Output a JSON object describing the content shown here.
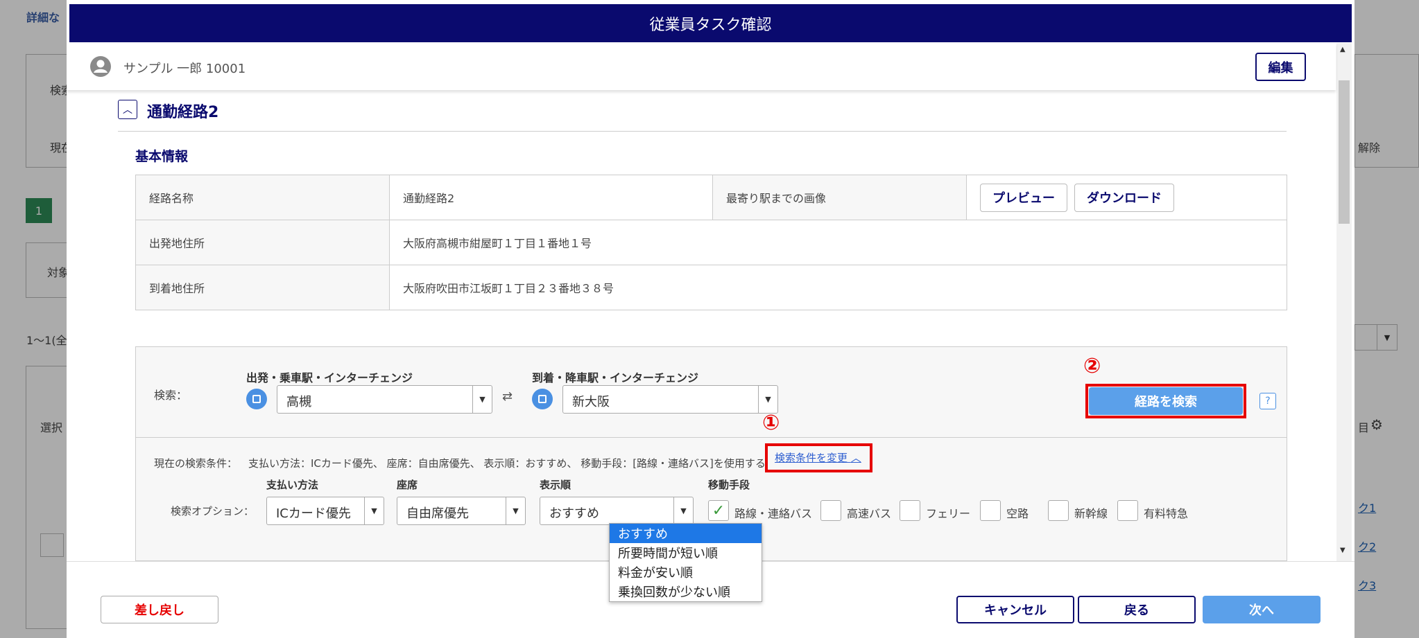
{
  "background": {
    "top_link": "詳細な",
    "label_search": "検索",
    "label_current": "現在",
    "step_number": "1",
    "filter_label": "対象",
    "count_text": "1～1(全",
    "column_select": "選択",
    "right_delete": "解除",
    "right_item": "目",
    "link1": "ク1",
    "link2": "ク2",
    "link3": "ク3"
  },
  "modal": {
    "title": "従業員タスク確認",
    "user": {
      "name": "サンプル 一郎 10001",
      "edit_label": "編集"
    },
    "section": {
      "title": "通勤経路2",
      "toggle_icon": "chevron-up-icon",
      "subsection_title": "基本情報",
      "table": {
        "route_name_label": "経路名称",
        "route_name_value": "通勤経路2",
        "image_label": "最寄り駅までの画像",
        "preview_label": "プレビュー",
        "download_label": "ダウンロード",
        "departure_label": "出発地住所",
        "departure_value": "大阪府高槻市紺屋町１丁目１番地１号",
        "arrival_label": "到着地住所",
        "arrival_value": "大阪府吹田市江坂町１丁目２３番地３８号"
      }
    },
    "search": {
      "label": "検索：",
      "from_label": "出発・乗車駅・インターチェンジ",
      "from_value": "高槻",
      "to_label": "到着・降車駅・インターチェンジ",
      "to_value": "新大阪",
      "search_button": "経路を検索",
      "help": "?",
      "marker2": "②",
      "marker1": "①",
      "current_conditions_label": "現在の検索条件：",
      "current_conditions_text": "支払い方法：ICカード優先、 座席：自由席優先、 表示順：おすすめ、 移動手段：[路線・連絡バス]を使用する",
      "change_conditions_link": "検索条件を変更",
      "options_label": "検索オプション：",
      "payment_label": "支払い方法",
      "payment_value": "ICカード優先",
      "seat_label": "座席",
      "seat_value": "自由席優先",
      "order_label": "表示順",
      "order_value": "おすすめ",
      "order_options": [
        "おすすめ",
        "所要時間が短い順",
        "料金が安い順",
        "乗換回数が少ない順"
      ],
      "transport_label": "移動手段",
      "transport": [
        {
          "label": "路線・連絡バス",
          "checked": true
        },
        {
          "label": "高速バス",
          "checked": false
        },
        {
          "label": "フェリー",
          "checked": false
        },
        {
          "label": "空路",
          "checked": false
        },
        {
          "label": "新幹線",
          "checked": false
        },
        {
          "label": "有料特急",
          "checked": false
        }
      ]
    },
    "footer": {
      "reject_label": "差し戻し",
      "cancel_label": "キャンセル",
      "back_label": "戻る",
      "next_label": "次へ"
    }
  },
  "colors": {
    "title_bar": "#0a0a6e",
    "primary": "#5ba0ea",
    "highlight": "#e60000",
    "selected_option": "#1e78e6"
  }
}
